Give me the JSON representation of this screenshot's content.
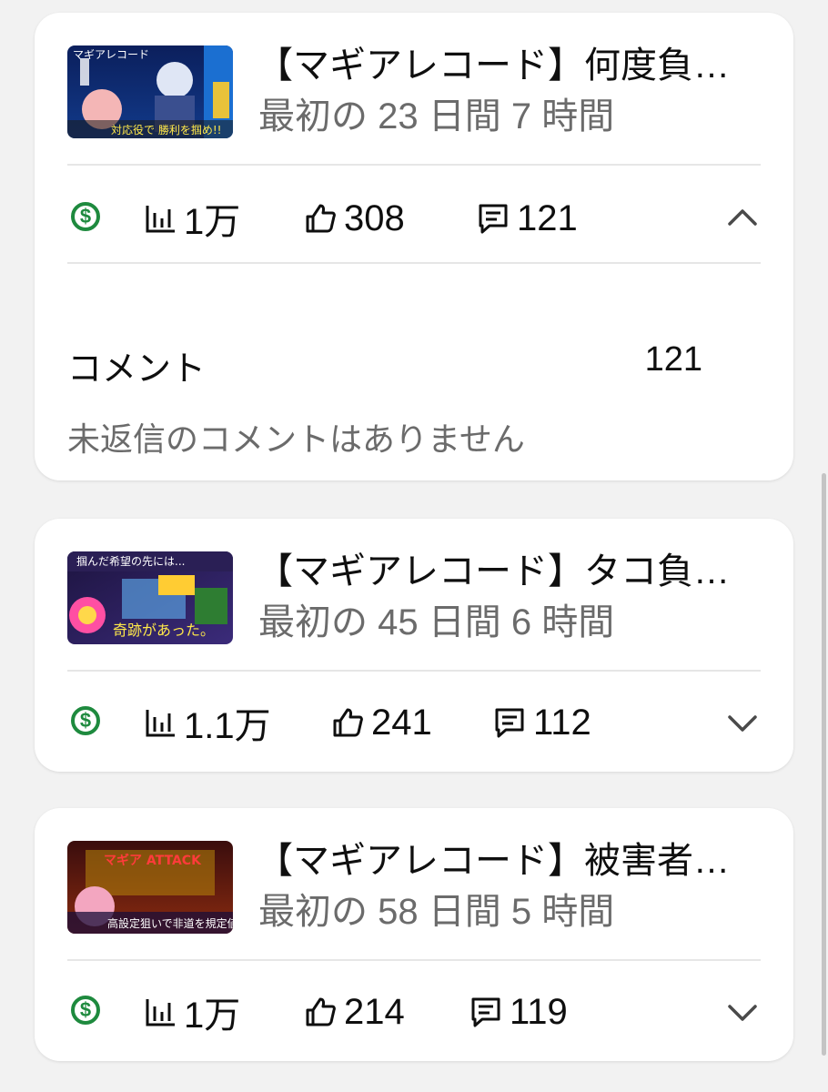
{
  "colors": {
    "monetization_green": "#1e8a3e",
    "secondary_text": "#6b6b6b",
    "divider": "#e6e6e6"
  },
  "videos": [
    {
      "title": "【マギアレコード】何度負…",
      "subtitle": "最初の 23 日間 7 時間",
      "views": "1万",
      "likes": "308",
      "comments": "121",
      "expanded": true,
      "thumbnail_icon": "video-thumbnail",
      "thumbnail_text": "マギアレコード",
      "thumbnail_caption": "対応役で 勝利を掴め!!"
    },
    {
      "title": "【マギアレコード】タコ負…",
      "subtitle": "最初の 45 日間 6 時間",
      "views": "1.1万",
      "likes": "241",
      "comments": "112",
      "expanded": false,
      "thumbnail_icon": "video-thumbnail",
      "thumbnail_text": "掴んだ希望の先には...",
      "thumbnail_caption": "奇跡があった。"
    },
    {
      "title": "【マギアレコード】被害者…",
      "subtitle": "最初の 58 日間 5 時間",
      "views": "1万",
      "likes": "214",
      "comments": "119",
      "expanded": false,
      "thumbnail_icon": "video-thumbnail",
      "thumbnail_text": "マギア ATTACK",
      "thumbnail_caption": "高設定狙いで非道を規定値"
    }
  ],
  "comments_panel": {
    "label": "コメント",
    "count": "121",
    "empty_message": "未返信のコメントはありません"
  },
  "icons": {
    "monetization": "dollar-circle-icon",
    "views": "bar-chart-icon",
    "likes": "thumbs-up-icon",
    "comments": "comment-icon",
    "expand": "chevron-up-icon",
    "collapse": "chevron-down-icon"
  }
}
